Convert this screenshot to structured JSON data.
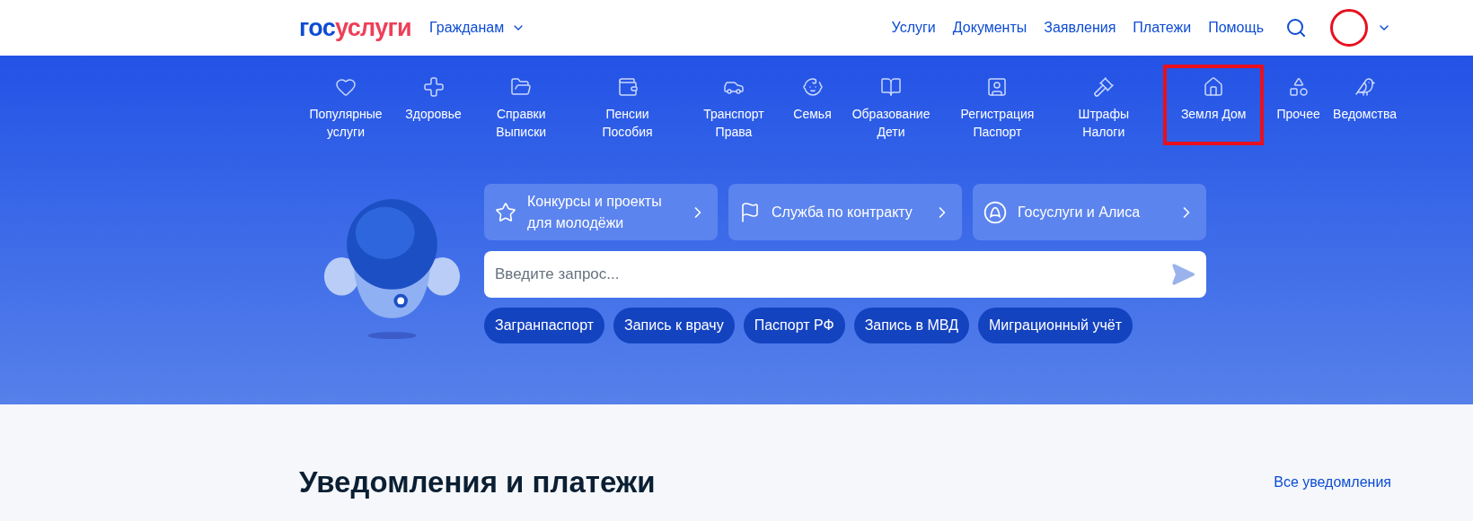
{
  "header": {
    "logo": [
      {
        "text": "гос",
        "color": "#0d4cd3"
      },
      {
        "text": "услуги",
        "color": "#ee3f58"
      }
    ],
    "audience": "Гражданам",
    "nav": [
      "Услуги",
      "Документы",
      "Заявления",
      "Платежи",
      "Помощь"
    ],
    "avatar_marked": true
  },
  "categories": [
    {
      "kind": "heart",
      "label": "Популярные услуги",
      "highlighted": false
    },
    {
      "kind": "cross",
      "label": "Здоровье",
      "highlighted": false
    },
    {
      "kind": "folder",
      "label": "Справки Выписки",
      "highlighted": false
    },
    {
      "kind": "wallet",
      "label": "Пенсии Пособия",
      "highlighted": false
    },
    {
      "kind": "car",
      "label": "Транспорт Права",
      "highlighted": false
    },
    {
      "kind": "stroller",
      "label": "Семья",
      "highlighted": false
    },
    {
      "kind": "book",
      "label": "Образование Дети",
      "highlighted": false
    },
    {
      "kind": "id",
      "label": "Регистрация Паспорт",
      "highlighted": false
    },
    {
      "kind": "gavel",
      "label": "Штрафы Налоги",
      "highlighted": false
    },
    {
      "kind": "house",
      "label": "Земля Дом",
      "highlighted": true
    },
    {
      "kind": "shapes",
      "label": "Прочее",
      "highlighted": false
    },
    {
      "kind": "bird",
      "label": "Ведомства",
      "highlighted": false
    }
  ],
  "promo_cards": [
    {
      "kind": "star",
      "label": "Конкурсы и проекты для молодёжи"
    },
    {
      "kind": "flag",
      "label": "Служба по контракту"
    },
    {
      "kind": "alice",
      "label": "Госуслуги и Алиса"
    }
  ],
  "search": {
    "placeholder": "Введите запрос..."
  },
  "quick_links": [
    "Загранпаспорт",
    "Запись к врачу",
    "Паспорт РФ",
    "Запись в МВД",
    "Миграционный учёт"
  ],
  "notifications": {
    "title": "Уведомления и платежи",
    "link": "Все уведомления"
  }
}
